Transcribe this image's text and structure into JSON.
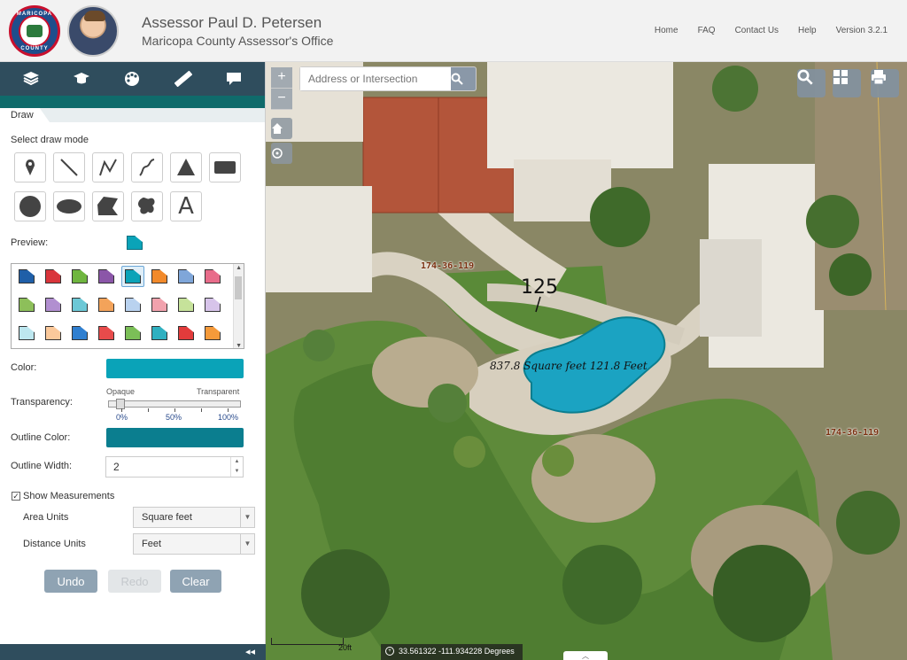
{
  "header": {
    "seal_top_text": "MARICOPA",
    "seal_bottom_text": "COUNTY",
    "title": "Assessor Paul D. Petersen",
    "subtitle": "Maricopa County Assessor's Office",
    "nav": [
      "Home",
      "FAQ",
      "Contact Us",
      "Help",
      "Version 3.2.1"
    ]
  },
  "toolbar": {
    "icons": [
      "layers-icon",
      "education-cap-icon",
      "palette-icon",
      "ruler-icon",
      "comment-icon"
    ]
  },
  "draw_panel": {
    "tab_label": "Draw",
    "select_mode_label": "Select draw mode",
    "modes": [
      "point",
      "line",
      "polyline",
      "freehand-line",
      "triangle",
      "rectangle",
      "circle",
      "ellipse",
      "polygon",
      "freehand-polygon",
      "text"
    ],
    "text_mode_glyph": "A",
    "preview_label": "Preview:",
    "palette_colors": [
      "#1f5fa8",
      "#d9353b",
      "#6fb63f",
      "#8b56a8",
      "#0aa3b8",
      "#f28a2b",
      "#7fa6d9",
      "#e86c8a",
      "#8dbf5a",
      "#b18fd0",
      "#6cc8d6",
      "#f3a35a",
      "#b9d2ef",
      "#f1a2ad",
      "#c6e29a",
      "#d7c4ea",
      "#bde7ef",
      "#fbc99b",
      "#2f7fd0",
      "#e84b4b",
      "#7bbf57",
      "#2fb0c0",
      "#e23b3b",
      "#f59a3a"
    ],
    "selected_index": 4,
    "color_label": "Color:",
    "color_value": "#0aa3b8",
    "transparency_label": "Transparency:",
    "transparency_left": "Opaque",
    "transparency_right": "Transparent",
    "transparency_ticks": [
      "0%",
      "50%",
      "100%"
    ],
    "transparency_value_pct": 0,
    "outline_color_label": "Outline Color:",
    "outline_color_value": "#0b7e8f",
    "outline_width_label": "Outline Width:",
    "outline_width_value": "2",
    "show_measurements_label": "Show Measurements",
    "show_measurements_checked": true,
    "area_units_label": "Area Units",
    "area_units_value": "Square feet",
    "distance_units_label": "Distance Units",
    "distance_units_value": "Feet",
    "undo_label": "Undo",
    "redo_label": "Redo",
    "clear_label": "Clear",
    "collapse_glyph": "◂◂"
  },
  "map": {
    "search_placeholder": "Address or Intersection",
    "zoom_in": "+",
    "zoom_out": "−",
    "parcel_labels": [
      "174-36-119",
      "174-36-119"
    ],
    "lot_number": "125",
    "measurement": "837.8 Square feet 121.8 Feet",
    "coordinates": "33.561322 -111.934228 Degrees",
    "scale_label": "20ft",
    "pool_color": "#1ba3c2"
  }
}
